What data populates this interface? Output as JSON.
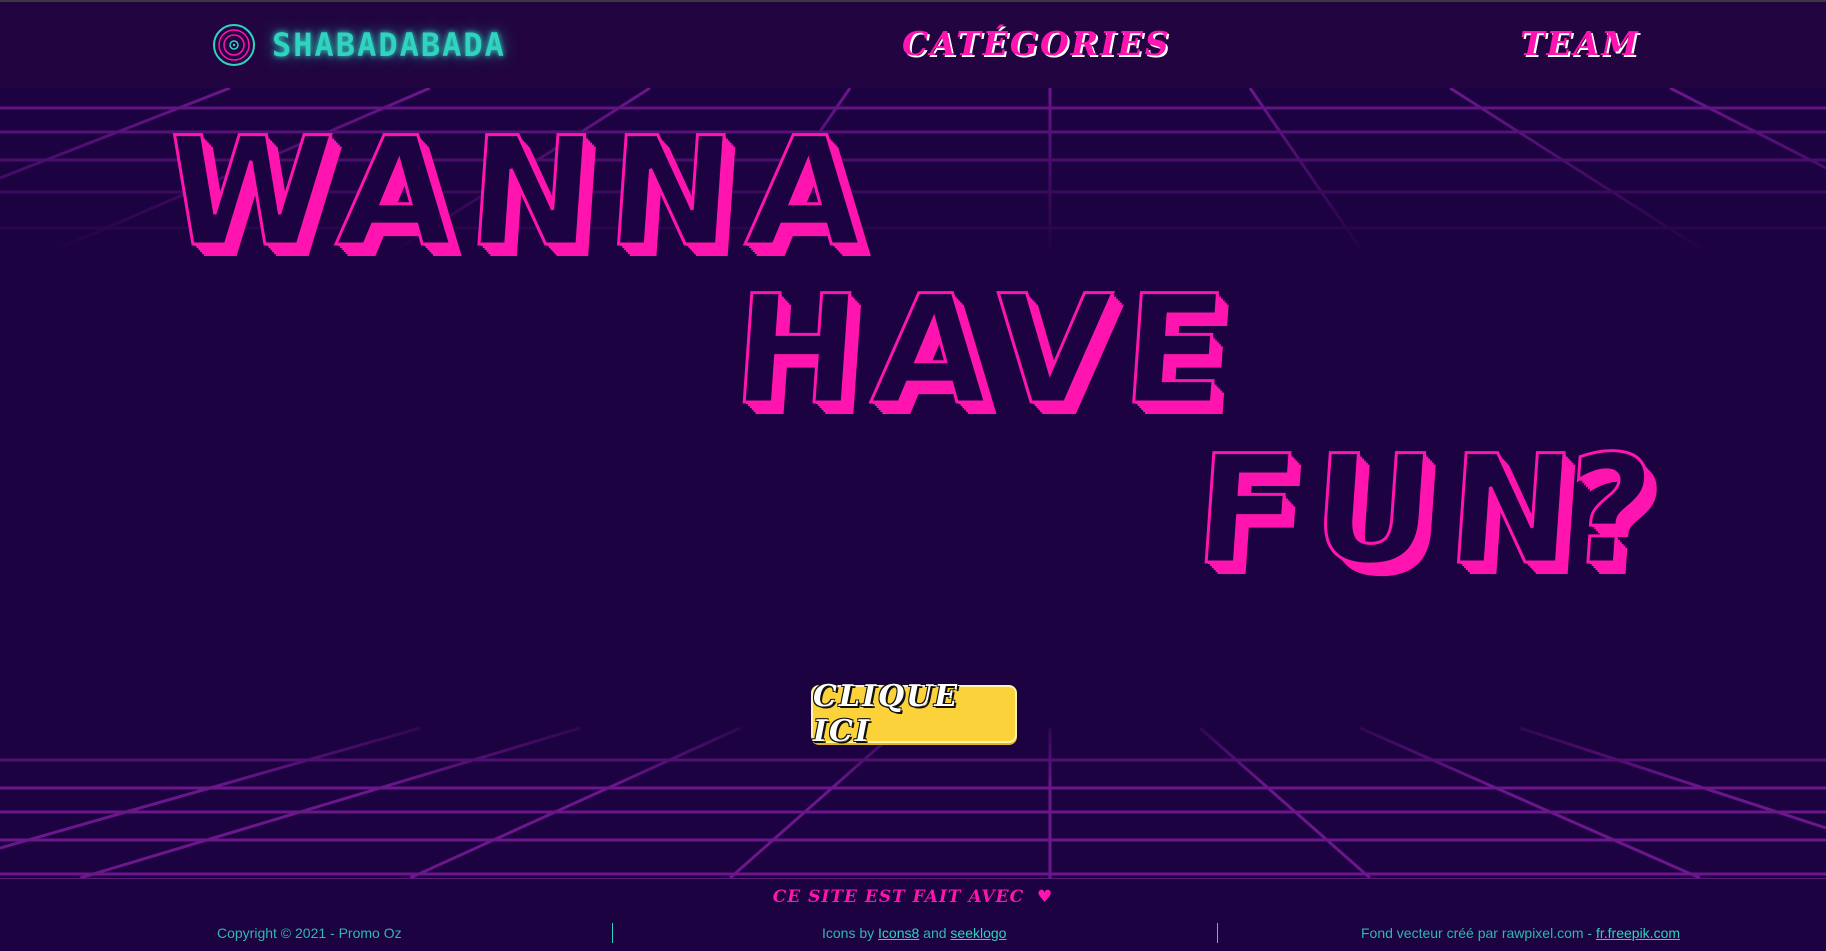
{
  "header": {
    "logo_text": "SHABADABADA",
    "nav": {
      "categories": "Catégories",
      "team": "Team"
    }
  },
  "hero": {
    "words": [
      "WANNA",
      "HAVE",
      "FUN",
      "?"
    ]
  },
  "cta": {
    "label": "Clique ici"
  },
  "footer": {
    "made_with": "Ce site est fait avec",
    "copyright": "Copyright © 2021 - Promo Oz",
    "icons_prefix": "Icons by",
    "icons_link_1": "Icons8",
    "icons_and": "and",
    "icons_link_2": "seeklogo",
    "background_prefix": "Fond vecteur créé par rawpixel.com -",
    "background_link": "fr.freepik.com"
  },
  "colors": {
    "background": "#1c0240",
    "accent_pink": "#ff14b0",
    "accent_teal": "#2fd3c0",
    "button_yellow": "#fcd23a"
  },
  "icons": {
    "logo": "vinyl-record-icon",
    "heart": "heart-icon"
  }
}
